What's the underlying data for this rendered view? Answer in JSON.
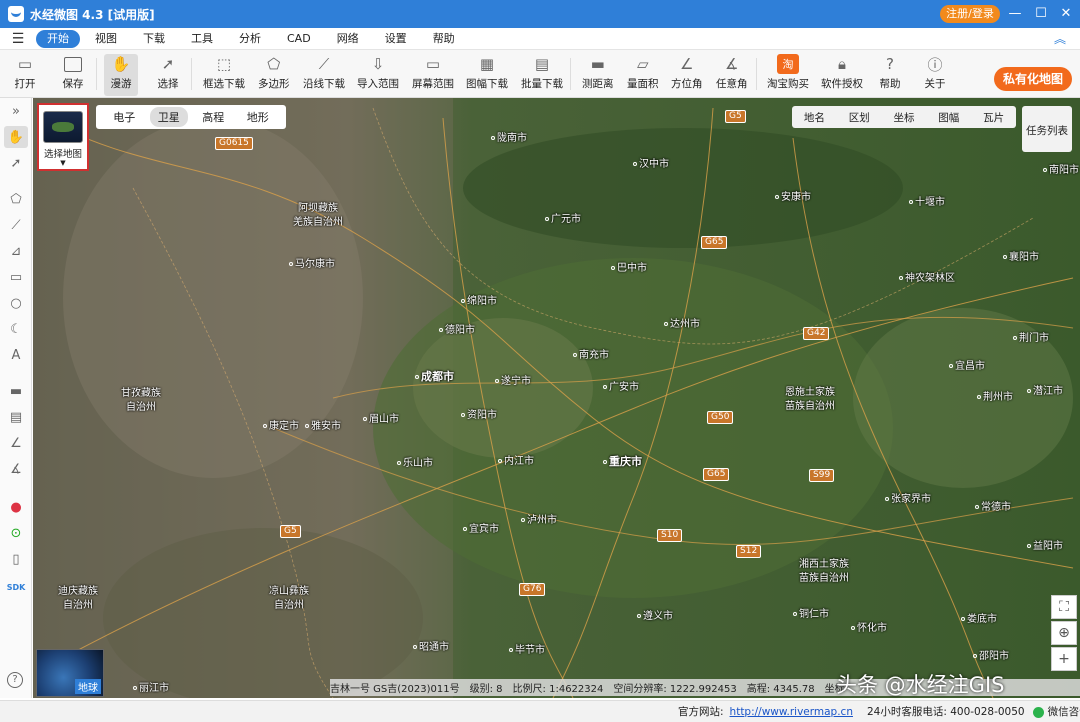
{
  "app": {
    "title": "水经微图 4.3 [试用版]",
    "login_label": "注册/登录"
  },
  "window": {
    "min": "—",
    "max": "☐",
    "close": "✕"
  },
  "menu": {
    "items": [
      "开始",
      "视图",
      "下载",
      "工具",
      "分析",
      "CAD",
      "网络",
      "设置",
      "帮助"
    ],
    "active": "开始"
  },
  "toolbar": {
    "open": "打开",
    "save": "保存",
    "roam": "漫游",
    "select": "选择",
    "box_download": "框选下载",
    "polygon": "多边形",
    "line_download": "沿线下载",
    "import_range": "导入范围",
    "screen_range": "屏幕范围",
    "sheet_download": "图幅下载",
    "batch_download": "批量下载",
    "measure_distance": "测距离",
    "measure_area": "量面积",
    "azimuth": "方位角",
    "any_angle": "任意角",
    "taobao": "淘宝购买",
    "license": "软件授权",
    "help": "帮助",
    "about": "关于",
    "private_map": "私有化地图"
  },
  "map_panel": {
    "select_map": "选择地图",
    "types": [
      "电子",
      "卫星",
      "高程",
      "地形"
    ],
    "active_type": "卫星",
    "overlays": [
      "地名",
      "区划",
      "坐标",
      "图幅",
      "瓦片"
    ],
    "task_list": "任务列表",
    "globe_label": "地球"
  },
  "cities": {
    "longnan": "陇南市",
    "hanzhong": "汉中市",
    "ankang": "安康市",
    "shiyan": "十堰市",
    "nanyang": "南阳市",
    "xiangyang": "襄阳市",
    "guangyuan": "广元市",
    "bazhong": "巴中市",
    "shennongjia": "神农架林区",
    "mianyang": "绵阳市",
    "dazhou": "达州市",
    "jingmen": "荆门市",
    "deyang": "德阳市",
    "nanchong": "南充市",
    "yichang": "宜昌市",
    "chengdu": "成都市",
    "suining": "遂宁市",
    "guangan": "广安市",
    "jingzhou": "荆州市",
    "qianjiang": "潜江市",
    "kangding": "康定市",
    "yaan": "雅安市",
    "meishan": "眉山市",
    "ziyang": "资阳市",
    "leshan": "乐山市",
    "neijiang": "内江市",
    "chongqing": "重庆市",
    "zhangjiajie": "张家界市",
    "changde": "常德市",
    "yibin": "宜宾市",
    "luzhou": "泸州市",
    "yiyang": "益阳市",
    "zunyi": "遵义市",
    "tongren": "铜仁市",
    "huaihua": "怀化市",
    "loudi": "娄底市",
    "shaoyang": "邵阳市",
    "zhaotong": "昭通市",
    "bijie": "毕节市",
    "lijiang": "丽江市",
    "maerkang": "马尔康市"
  },
  "regions": {
    "aba": "阿坝藏族\n羌族自治州",
    "ganzi": "甘孜藏族\n自治州",
    "liangshan": "凉山彝族\n自治州",
    "diqing": "迪庆藏族\n自治州",
    "enshi": "恩施土家族\n苗族自治州",
    "xiangxi": "湘西土家族\n苗族自治州"
  },
  "highways": [
    "G5",
    "G0615",
    "G65",
    "G42",
    "G50",
    "S99",
    "G65",
    "S10",
    "S12",
    "G5",
    "G76"
  ],
  "map_status": {
    "source": "吉林一号 GS吉(2023)011号",
    "level": "级别:    8",
    "scale": "比例尺: 1:4622324",
    "resolution": "空间分辨率: 1222.992453",
    "elevation": "高程:    4345.78",
    "coord": "坐标"
  },
  "watermark": "头条 @水经注GIS",
  "statusbar": {
    "site_label": "官方网站:",
    "site_url": "http://www.rivermap.cn",
    "hotline": "24小时客服电话: 400-028-0050",
    "wechat": "微信咨询"
  }
}
